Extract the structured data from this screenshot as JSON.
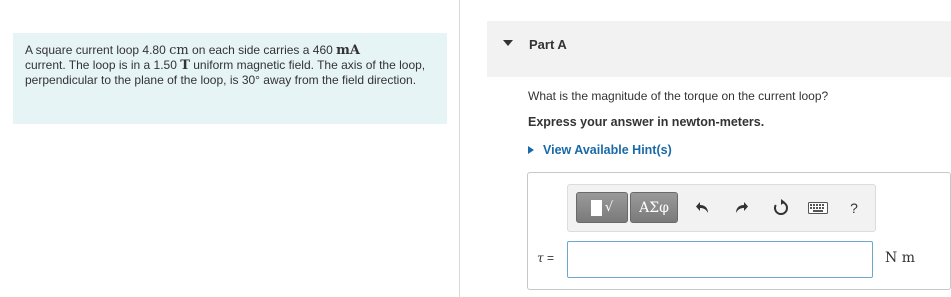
{
  "problem": {
    "text_1": "A square current loop 4.80 ",
    "unit_cm": "cm",
    "text_2": " on each side carries a 460 ",
    "unit_ma": "mA",
    "text_3": "current. The loop is in a 1.50 ",
    "unit_t": "T",
    "text_4": " uniform magnetic field. The axis of the loop, perpendicular to the plane of the loop, is 30° away from the field direction."
  },
  "part": {
    "title": "Part A"
  },
  "question": "What is the magnitude of the torque on the current loop?",
  "instruction": "Express your answer in newton-meters.",
  "hint_link": "View Available Hint(s)",
  "toolbar": {
    "templates_icon": "templates-icon",
    "sqrt_symbol": "√",
    "symbols_label": "ΑΣφ",
    "undo_icon": "undo-icon",
    "redo_icon": "redo-icon",
    "reset_icon": "reset-icon",
    "keyboard_icon": "keyboard-icon",
    "help_label": "?"
  },
  "answer": {
    "label_symbol": "τ",
    "label_equals": " =",
    "value": "",
    "unit": "N m"
  }
}
